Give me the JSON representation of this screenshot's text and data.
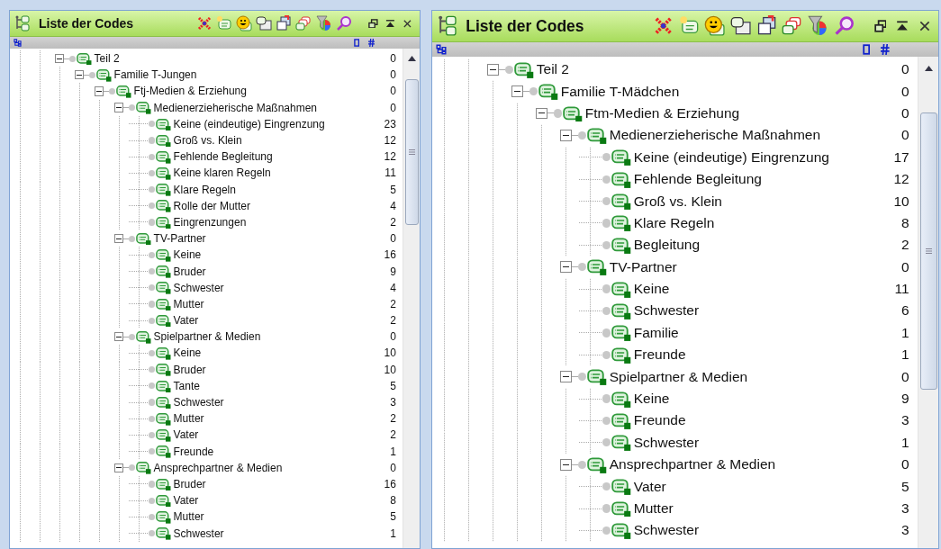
{
  "panels": [
    {
      "title": "Liste der Codes",
      "tree": [
        {
          "label": "Teil 2",
          "count": "0",
          "expanded": true,
          "children": [
            {
              "label": "Familie T-Jungen",
              "count": "0",
              "expanded": true,
              "children": [
                {
                  "label": "Ftj-Medien & Erziehung",
                  "count": "0",
                  "expanded": true,
                  "children": [
                    {
                      "label": "Medienerzieherische Maßnahmen",
                      "count": "0",
                      "expanded": true,
                      "children": [
                        {
                          "label": "Keine (eindeutige) Eingrenzung",
                          "count": "23"
                        },
                        {
                          "label": "Groß vs. Klein",
                          "count": "12"
                        },
                        {
                          "label": "Fehlende Begleitung",
                          "count": "12"
                        },
                        {
                          "label": "Keine klaren Regeln",
                          "count": "11"
                        },
                        {
                          "label": "Klare Regeln",
                          "count": "5"
                        },
                        {
                          "label": "Rolle der Mutter",
                          "count": "4"
                        },
                        {
                          "label": "Eingrenzungen",
                          "count": "2"
                        }
                      ]
                    },
                    {
                      "label": "TV-Partner",
                      "count": "0",
                      "expanded": true,
                      "children": [
                        {
                          "label": "Keine",
                          "count": "16"
                        },
                        {
                          "label": "Bruder",
                          "count": "9"
                        },
                        {
                          "label": "Schwester",
                          "count": "4"
                        },
                        {
                          "label": "Mutter",
                          "count": "2"
                        },
                        {
                          "label": "Vater",
                          "count": "2"
                        }
                      ]
                    },
                    {
                      "label": "Spielpartner & Medien",
                      "count": "0",
                      "expanded": true,
                      "children": [
                        {
                          "label": "Keine",
                          "count": "10"
                        },
                        {
                          "label": "Bruder",
                          "count": "10"
                        },
                        {
                          "label": "Tante",
                          "count": "5"
                        },
                        {
                          "label": "Schwester",
                          "count": "3"
                        },
                        {
                          "label": "Mutter",
                          "count": "2"
                        },
                        {
                          "label": "Vater",
                          "count": "2"
                        },
                        {
                          "label": "Freunde",
                          "count": "1"
                        }
                      ]
                    },
                    {
                      "label": "Ansprechpartner & Medien",
                      "count": "0",
                      "expanded": true,
                      "children": [
                        {
                          "label": "Bruder",
                          "count": "16"
                        },
                        {
                          "label": "Vater",
                          "count": "8"
                        },
                        {
                          "label": "Mutter",
                          "count": "5"
                        },
                        {
                          "label": "Schwester",
                          "count": "1"
                        }
                      ]
                    }
                  ]
                }
              ]
            }
          ]
        }
      ]
    },
    {
      "title": "Liste der Codes",
      "tree": [
        {
          "label": "Teil 2",
          "count": "0",
          "expanded": true,
          "children": [
            {
              "label": "Familie T-Mädchen",
              "count": "0",
              "expanded": true,
              "children": [
                {
                  "label": "Ftm-Medien & Erziehung",
                  "count": "0",
                  "expanded": true,
                  "children": [
                    {
                      "label": "Medienerzieherische Maßnahmen",
                      "count": "0",
                      "expanded": true,
                      "children": [
                        {
                          "label": "Keine (eindeutige) Eingrenzung",
                          "count": "17"
                        },
                        {
                          "label": "Fehlende Begleitung",
                          "count": "12"
                        },
                        {
                          "label": "Groß vs. Klein",
                          "count": "10"
                        },
                        {
                          "label": "Klare Regeln",
                          "count": "8"
                        },
                        {
                          "label": "Begleitung",
                          "count": "2"
                        }
                      ]
                    },
                    {
                      "label": "TV-Partner",
                      "count": "0",
                      "expanded": true,
                      "children": [
                        {
                          "label": "Keine",
                          "count": "11"
                        },
                        {
                          "label": "Schwester",
                          "count": "6"
                        },
                        {
                          "label": "Familie",
                          "count": "1"
                        },
                        {
                          "label": "Freunde",
                          "count": "1"
                        }
                      ]
                    },
                    {
                      "label": "Spielpartner & Medien",
                      "count": "0",
                      "expanded": true,
                      "children": [
                        {
                          "label": "Keine",
                          "count": "9"
                        },
                        {
                          "label": "Freunde",
                          "count": "3"
                        },
                        {
                          "label": "Schwester",
                          "count": "1"
                        }
                      ]
                    },
                    {
                      "label": "Ansprechpartner & Medien",
                      "count": "0",
                      "expanded": true,
                      "children": [
                        {
                          "label": "Vater",
                          "count": "5"
                        },
                        {
                          "label": "Mutter",
                          "count": "3"
                        },
                        {
                          "label": "Schwester",
                          "count": "3"
                        }
                      ]
                    }
                  ]
                }
              ]
            }
          ]
        }
      ]
    }
  ]
}
